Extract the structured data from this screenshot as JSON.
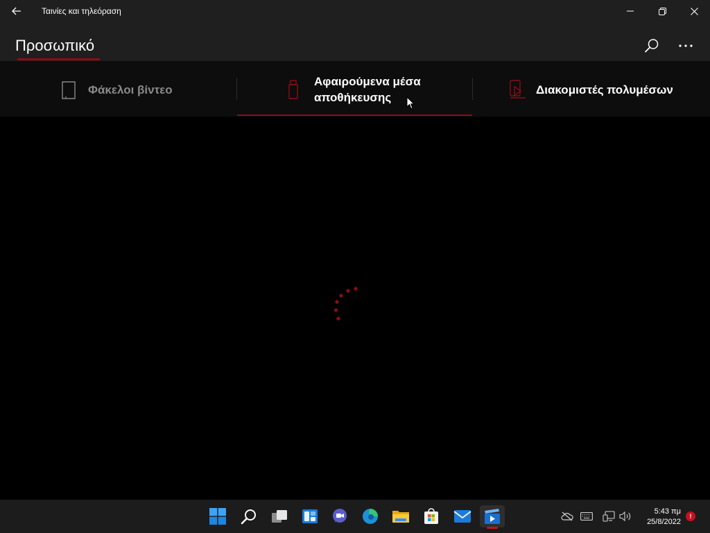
{
  "window": {
    "app_title": "Ταινίες και τηλεόραση",
    "back_icon": "arrow-left-icon",
    "minimize_icon": "minimize-icon",
    "maximize_icon": "restore-icon",
    "close_icon": "close-icon"
  },
  "header": {
    "page_title": "Προσωπικό",
    "search_icon": "search-icon",
    "more_icon": "more-icon"
  },
  "tabs": [
    {
      "label": "Φάκελοι βίντεο",
      "icon": "video-folder-icon",
      "active": false
    },
    {
      "label": "Αφαιρούμενα μέσα αποθήκευσης",
      "icon": "usb-drive-icon",
      "active": true
    },
    {
      "label": "Διακομιστές πολυμέσων",
      "icon": "media-server-icon",
      "active": false
    }
  ],
  "content": {
    "state": "loading",
    "spinner_icon": "loading-spinner-icon"
  },
  "taskbar": {
    "apps": [
      {
        "name": "Start",
        "icon": "windows-start-icon"
      },
      {
        "name": "Search",
        "icon": "search-icon"
      },
      {
        "name": "Task View",
        "icon": "task-view-icon"
      },
      {
        "name": "Widgets",
        "icon": "widgets-icon"
      },
      {
        "name": "Chat",
        "icon": "chat-icon"
      },
      {
        "name": "Microsoft Edge",
        "icon": "edge-icon"
      },
      {
        "name": "File Explorer",
        "icon": "file-explorer-icon"
      },
      {
        "name": "Microsoft Store",
        "icon": "store-icon"
      },
      {
        "name": "Mail",
        "icon": "mail-icon"
      },
      {
        "name": "Movies & TV",
        "icon": "movies-tv-icon",
        "active": true
      }
    ],
    "tray": {
      "icons": [
        "onedrive-offline-icon",
        "keyboard-icon",
        "network-icon",
        "volume-icon"
      ],
      "time": "5:43 πμ",
      "date": "25/8/2022",
      "notification_badge": "!"
    }
  },
  "colors": {
    "accent": "#8c0d16",
    "titlebar_bg": "#1f1f1f",
    "tabs_bg": "#0d0d0d",
    "content_bg": "#000000",
    "taskbar_bg": "#1c1c1c"
  }
}
